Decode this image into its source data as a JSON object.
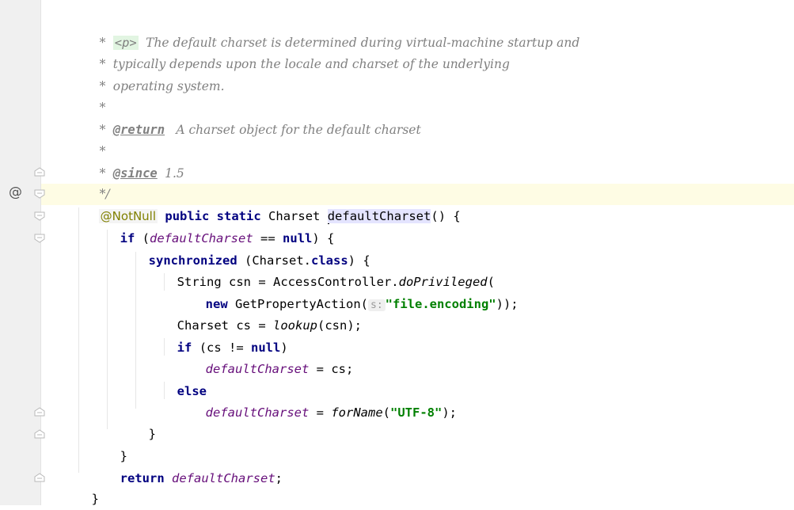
{
  "gutter": {
    "override_marker": "@"
  },
  "code": {
    "doc_lines": [
      {
        "prefix": "*",
        "text": "The default charset is determined during virtual-machine startup and",
        "tag": "<p>"
      },
      {
        "prefix": "*",
        "text": "typically depends upon the locale and charset of the underlying"
      },
      {
        "prefix": "*",
        "text": "operating system."
      },
      {
        "prefix": "*",
        "text": ""
      },
      {
        "prefix": "*",
        "doctag": "@return",
        "text": " A charset object for the default charset"
      },
      {
        "prefix": "*",
        "text": ""
      },
      {
        "prefix": "*",
        "doctag": "@since",
        "text": "1.5"
      },
      {
        "prefix": "*/",
        "text": ""
      }
    ],
    "signature": {
      "annotation": "@NotNull",
      "modifiers": "public static",
      "type": "Charset",
      "name": "defaultCharset",
      "rest": "() {"
    },
    "body": {
      "if_kw": "if",
      "field": "defaultCharset",
      "eq": "==",
      "null_kw": "null",
      "close": ") {",
      "sync_kw": "synchronized",
      "sync_arg": "(Charset.",
      "class_kw": "class",
      "sync_close": ") {",
      "line_csn_a": "String csn = AccessController.",
      "do_priv": "doPrivileged",
      "line_csn_b": "(",
      "new_kw": "new",
      "gpa": "GetPropertyAction(",
      "param_hint": "s:",
      "str_encoding": "\"file.encoding\"",
      "gpa_close": "));",
      "line_cs_a": "Charset cs = ",
      "lookup": "lookup",
      "line_cs_b": "(csn);",
      "if2_kw": "if",
      "if2_a": "(cs != ",
      "if2_null": "null",
      "if2_b": ")",
      "assign1_field": "defaultCharset",
      "assign1_rest": " = cs;",
      "else_kw": "else",
      "assign2_field": "defaultCharset",
      "assign2_a": " = ",
      "forname": "forName",
      "assign2_b": "(",
      "str_utf8": "\"UTF-8\"",
      "assign2_c": ");",
      "brace": "}",
      "return_kw": "return",
      "return_field": "defaultCharset",
      "return_end": ";"
    }
  }
}
